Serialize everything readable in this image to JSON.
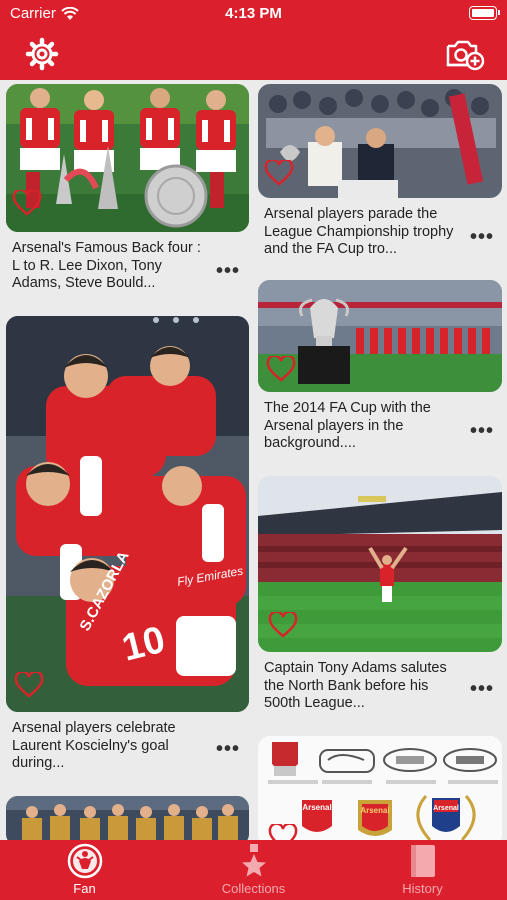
{
  "status_bar": {
    "carrier": "Carrier",
    "time": "4:13 PM"
  },
  "header": {
    "settings_icon": "gear-icon",
    "add_icon": "camera-plus-icon",
    "accent": "#db1f2c"
  },
  "feed": {
    "cards": [
      {
        "caption": "Arsenal's Famous Back four : L to R. Lee Dixon, Tony Adams, Steve Bould...",
        "more": "•••",
        "liked": false
      },
      {
        "caption": "Arsenal players parade the League Championship trophy and the FA Cup tro...",
        "more": "•••",
        "liked": false
      },
      {
        "caption": "The 2014 FA Cup with the Arsenal players in the background....",
        "more": "•••",
        "liked": false
      },
      {
        "caption": "Arsenal players celebrate Laurent Koscielny's goal during...",
        "more": "•••",
        "liked": false
      },
      {
        "caption": "Captain Tony Adams salutes the North Bank before his 500th League...",
        "more": "•••",
        "liked": false
      },
      {
        "caption": "",
        "more": "",
        "liked": false
      },
      {
        "caption": "",
        "more": "",
        "liked": false
      }
    ],
    "photo_texts": {
      "crest_top": "Arsenal",
      "crest_mid": "Arsenal",
      "crest_right": "Arsenal",
      "shirt_number": "10",
      "shirt_name": "S.CAZORLA",
      "sponsor": "Fly Emirates"
    }
  },
  "tabbar": {
    "tabs": [
      {
        "label": "Fan",
        "icon": "globe-person-icon",
        "active": true
      },
      {
        "label": "Collections",
        "icon": "star-trophy-icon",
        "active": false
      },
      {
        "label": "History",
        "icon": "book-icon",
        "active": false
      }
    ]
  }
}
